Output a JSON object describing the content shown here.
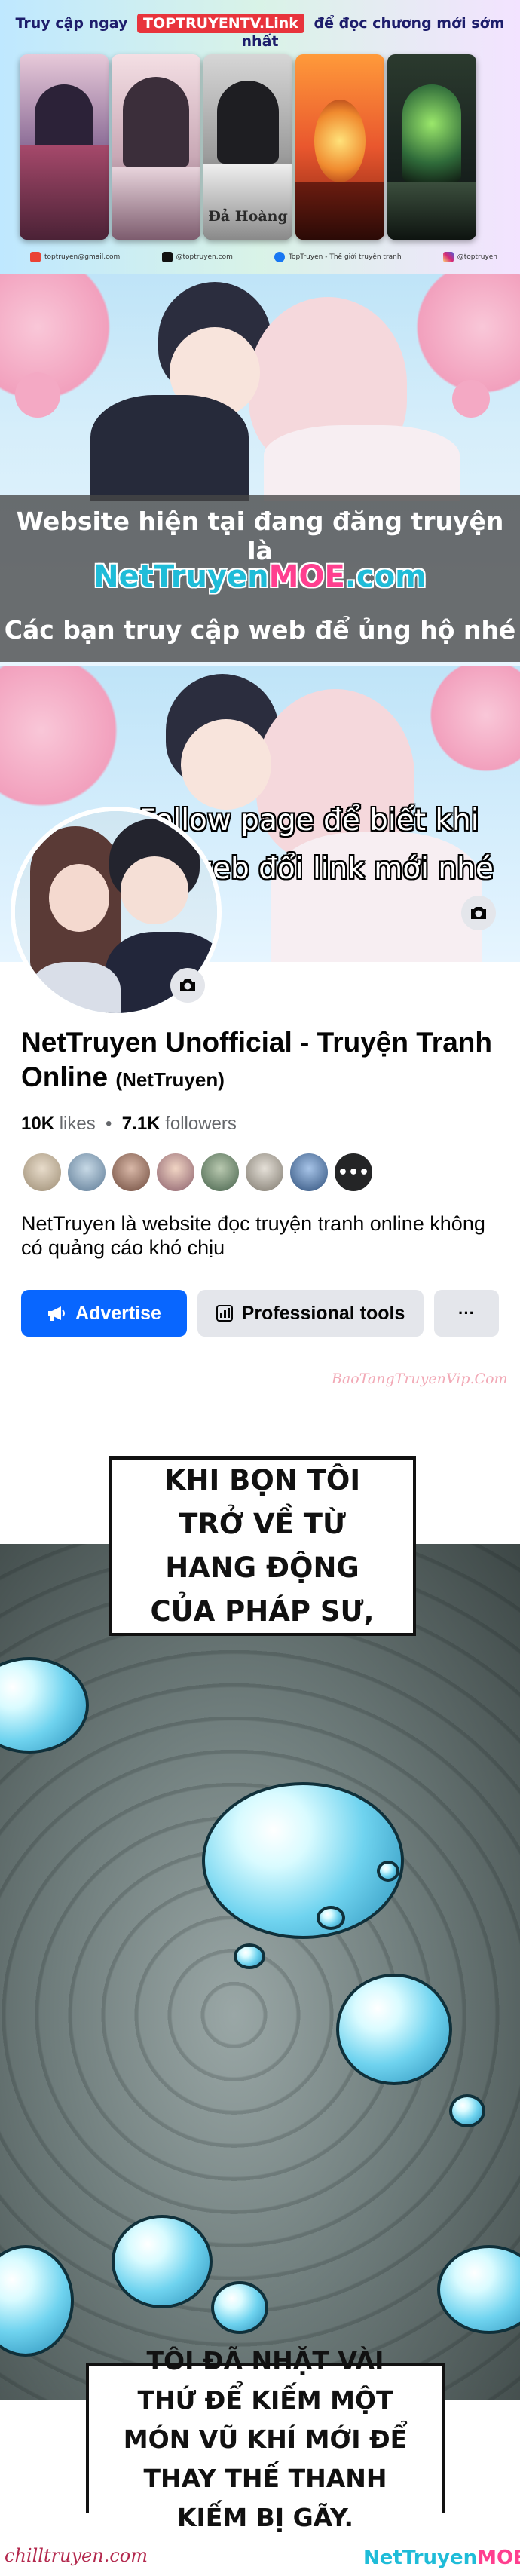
{
  "banner": {
    "prefix": "Truy cập ngay",
    "brand": "TOPTRUYENTV.Link",
    "suffix": "để đọc chương mới sớm nhất",
    "card_caption": "Đả Hoàng",
    "socials": [
      {
        "icon": "gmail-icon",
        "text": "toptruyen@gmail.com",
        "color": "#ea4335"
      },
      {
        "icon": "tiktok-icon",
        "text": "@toptruyen.com",
        "color": "#111111"
      },
      {
        "icon": "facebook-icon",
        "text": "TopTruyen - Thế giới truyện tranh",
        "color": "#1877f2"
      },
      {
        "icon": "instagram-icon",
        "text": "@toptruyen",
        "color": "#d62976"
      }
    ]
  },
  "notice": {
    "line1": "Website hiện tại đang đăng truyện là",
    "domain_main": "NetTruyen",
    "domain_moe": "MOE",
    "domain_tail": ".com",
    "line3": "Các bạn truy cập web để ủng hộ nhé"
  },
  "cover": {
    "follow_line1": "Follow page để biết khi",
    "follow_line2": "nào web đổi link mới nhé"
  },
  "profile": {
    "name": "NetTruyen Unofficial - Truyện Tranh Online",
    "handle": "(NetTruyen)",
    "likes_count": "10K",
    "likes_label": "likes",
    "followers_count": "7.1K",
    "followers_label": "followers",
    "description": "NetTruyen là website đọc truyện tranh online không có quảng cáo khó chịu",
    "advertise_label": "Advertise",
    "professional_label": "Professional tools",
    "more_label": "···"
  },
  "comic": {
    "watermark_top": "BaoTangTruyenVip.Com",
    "caption1": "KHI BỌN TÔI TRỞ VỀ TỪ HANG ĐỘNG CỦA PHÁP SƯ,",
    "caption2": "TÔI ĐÃ NHẶT VÀI THỨ ĐỂ KIẾM MỘT MÓN VŨ KHÍ MỚI ĐỂ THAY THẾ THANH KIẾM BỊ GÃY.",
    "watermark_left": "chilltruyen.com",
    "watermark_right_main": "NetTruyen",
    "watermark_right_moe": "MOE"
  },
  "colors": {
    "fb_blue": "#0866ff",
    "fb_gray": "#e4e6eb",
    "moe_pink": "#ff3f8f",
    "nettruyen_cyan": "#1fbcd8"
  }
}
